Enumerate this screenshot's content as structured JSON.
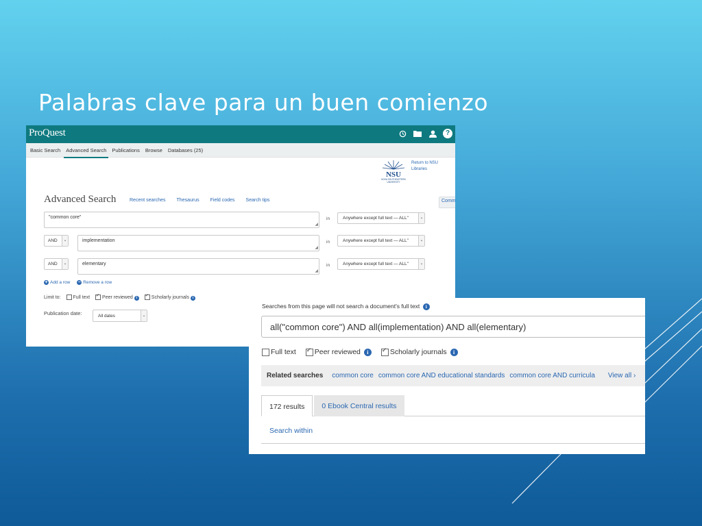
{
  "slide": {
    "title": "Palabras clave para un buen comienzo"
  },
  "proquest": {
    "logo": "ProQuest",
    "header_icons": [
      "history-icon",
      "folder-icon",
      "user-icon",
      "help-icon"
    ],
    "help_glyph": "?",
    "tabs": [
      {
        "label": "Basic Search",
        "active": false
      },
      {
        "label": "Advanced Search",
        "active": true
      },
      {
        "label": "Publications",
        "active": false
      },
      {
        "label": "Browse",
        "active": false
      },
      {
        "label": "Databases (25)",
        "active": false
      }
    ],
    "return_link": "Return to NSU Libraries",
    "nsu_logo": {
      "letters": "NSU",
      "line1": "NOVA SOUTHEASTERN",
      "line2": "UNIVERSITY"
    },
    "advanced_title": "Advanced Search",
    "sub_links": [
      {
        "label": "Command Line",
        "selected": true
      },
      {
        "label": "Recent searches",
        "selected": false
      },
      {
        "label": "Thesaurus",
        "selected": false
      },
      {
        "label": "Field codes",
        "selected": false
      },
      {
        "label": "Search tips",
        "selected": false
      }
    ],
    "rows": [
      {
        "operator": "",
        "term": "\"common core\"",
        "in_label": "in",
        "field": "Anywhere except full text — ALL\""
      },
      {
        "operator": "AND",
        "term": "implementation",
        "in_label": "in",
        "field": "Anywhere except full text — ALL\""
      },
      {
        "operator": "AND",
        "term": "elementary",
        "in_label": "in",
        "field": "Anywhere except full text — ALL\""
      }
    ],
    "add_row": "Add a row",
    "remove_row": "Remove a row",
    "limit_to_label": "Limit to:",
    "limits": [
      {
        "label": "Full text",
        "checked": false
      },
      {
        "label": "Peer reviewed",
        "checked": true
      },
      {
        "label": "Scholarly journals",
        "checked": true
      }
    ],
    "publication_date_label": "Publication date:",
    "publication_date_value": "All dates"
  },
  "results_panel": {
    "warning": "Searches from this page will not search a document's full text",
    "query": "all(\"common core\") AND all(implementation) AND all(elementary)",
    "limits": [
      {
        "label": "Full text",
        "checked": false
      },
      {
        "label": "Peer reviewed",
        "checked": true
      },
      {
        "label": "Scholarly journals",
        "checked": true
      }
    ],
    "related_label": "Related searches",
    "related_links": [
      "common core",
      "common core AND educational standards",
      "common core AND curricula"
    ],
    "view_all": "View all ›",
    "result_tabs": [
      {
        "label": "172 results",
        "active": true
      },
      {
        "label": "0 Ebook Central results",
        "active": false
      }
    ],
    "search_within": "Search within"
  },
  "colors": {
    "proquest_teal": "#0e7a80",
    "link_blue": "#2a67b1",
    "slide_gradient_top": "#62d1ee",
    "slide_gradient_bottom": "#0f5a98"
  }
}
